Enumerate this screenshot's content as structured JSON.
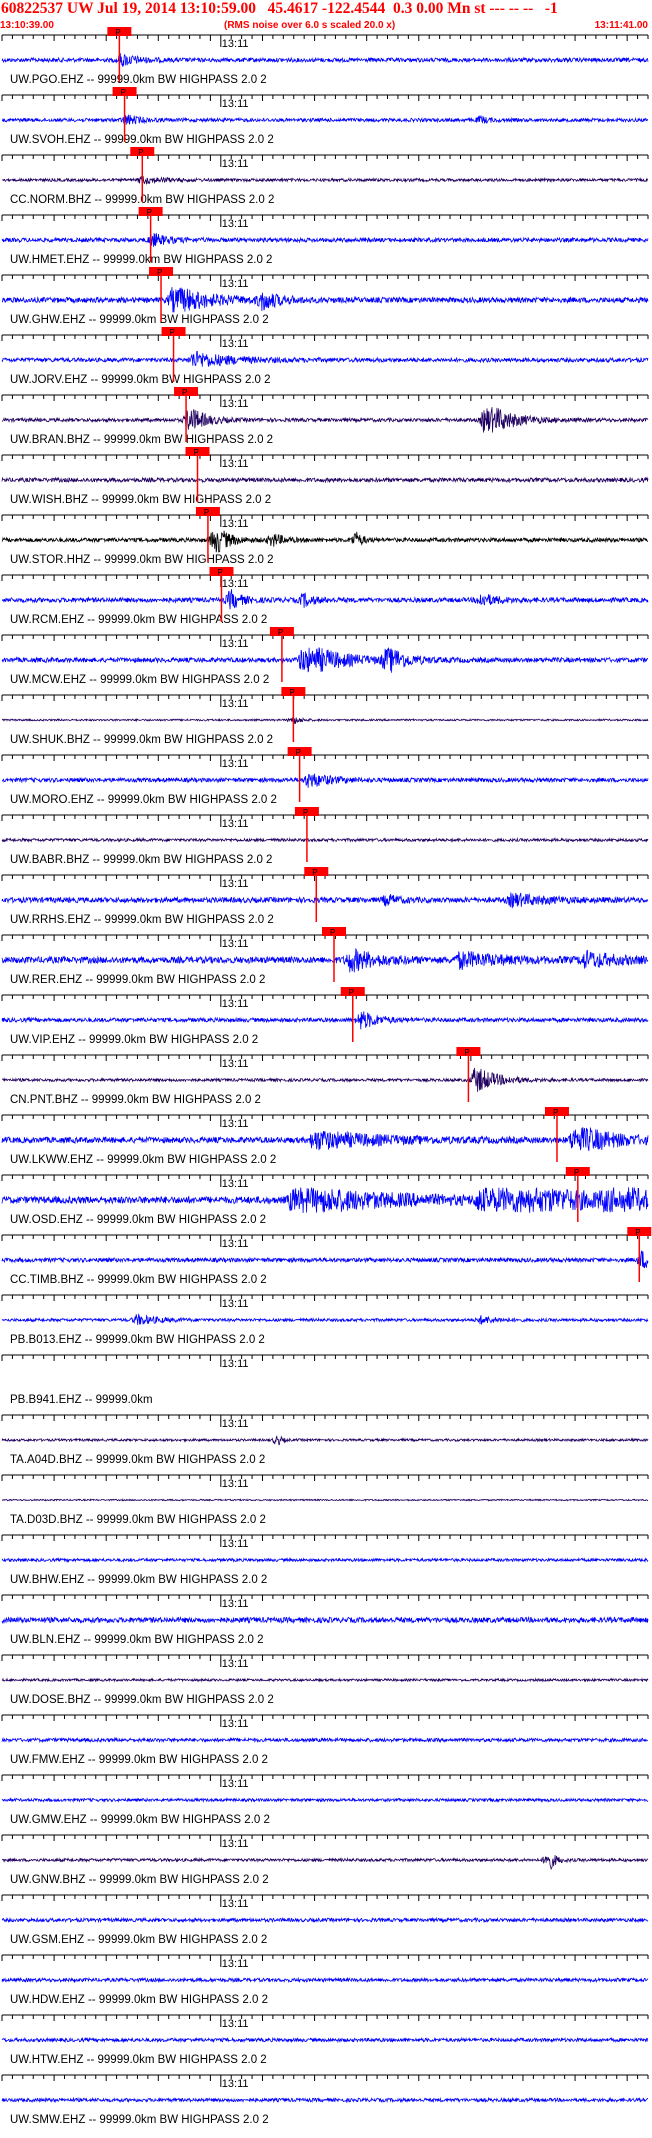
{
  "header": {
    "title": "60822537 UW Jul 19, 2014 13:10:59.00   45.4617 -122.4544  0.3 0.00 Mn st --- -- --   -1",
    "start_time": "13:10:39.00",
    "note": "(RMS noise over 6.0 s scaled 20.0 x)",
    "end_time": "13:11:41.00"
  },
  "chart_data": {
    "type": "line",
    "title": "60822537 UW Jul 19, 2014 13:10:59.00   45.4617 -122.4544  0.3 0.00 Mn st --- -- --   -1",
    "x_start": "13:10:39.00",
    "x_end": "13:11:41.00",
    "x_range_seconds": [
      0,
      62
    ],
    "minute_tick_label": "13:11",
    "minute_tick_seconds": 21,
    "tick_interval_seconds": 1,
    "pick_label": "P",
    "colors": {
      "blue": "#0000ff",
      "navy": "#200060",
      "black": "#000000",
      "pick": "#ff0000",
      "label_text": "#000000"
    },
    "series": [
      {
        "label": "UW.PGO.EHZ -- 99999.0km BW  HIGHPASS  2.0  2",
        "color": "#0000ff",
        "pick": 10.4,
        "amp": 0.35,
        "bursts": [
          [
            11.5,
            1.0,
            1.5
          ]
        ]
      },
      {
        "label": "UW.SVOH.EHZ -- 99999.0km BW  HIGHPASS  2.0  2",
        "color": "#0000ff",
        "pick": 10.9,
        "amp": 0.3,
        "bursts": [
          [
            12.0,
            0.8,
            1.2
          ],
          [
            46,
            0.5,
            0.8
          ]
        ]
      },
      {
        "label": "CC.NORM.BHZ -- 99999.0km BW  HIGHPASS  2.0  2",
        "color": "#200060",
        "pick": 12.6,
        "amp": 0.25,
        "bursts": [
          [
            13.5,
            0.6,
            2.0
          ]
        ]
      },
      {
        "label": "UW.HMET.EHZ -- 99999.0km BW  HIGHPASS  2.0  2",
        "color": "#0000ff",
        "pick": 13.4,
        "amp": 0.35,
        "bursts": [
          [
            14.5,
            1.0,
            1.5
          ]
        ]
      },
      {
        "label": "UW.GHW.EHZ -- 99999.0km BW  HIGHPASS  2.0  2",
        "color": "#0000ff",
        "pick": 14.4,
        "amp": 0.45,
        "bursts": [
          [
            16.5,
            2.5,
            3.0
          ],
          [
            25,
            1.5,
            1.5
          ]
        ]
      },
      {
        "label": "UW.JORV.EHZ -- 99999.0km BW  HIGHPASS  2.0  2",
        "color": "#0000ff",
        "pick": 15.6,
        "amp": 0.35,
        "bursts": [
          [
            18.5,
            1.3,
            3.5
          ]
        ]
      },
      {
        "label": "UW.BRAN.BHZ -- 99999.0km BW  HIGHPASS  2.0  2",
        "color": "#200060",
        "pick": 16.8,
        "amp": 0.3,
        "bursts": [
          [
            18.0,
            2.2,
            1.5
          ],
          [
            46.5,
            3.0,
            2.2
          ]
        ]
      },
      {
        "label": "UW.WISH.BHZ -- 99999.0km BW  HIGHPASS  2.0  2",
        "color": "#200060",
        "pick": 17.9,
        "amp": 0.35,
        "bursts": []
      },
      {
        "label": "UW.STOR.HHZ -- 99999.0km BW  HIGHPASS  2.0  2",
        "color": "#000000",
        "pick": 18.9,
        "amp": 0.35,
        "bursts": [
          [
            20.5,
            2.5,
            1.2
          ],
          [
            26,
            1.0,
            1.0
          ],
          [
            34,
            1.2,
            0.6
          ]
        ]
      },
      {
        "label": "UW.RCM.EHZ -- 99999.0km BW  HIGHPASS  2.0  2",
        "color": "#0000ff",
        "pick": 20.2,
        "amp": 0.4,
        "bursts": [
          [
            22.0,
            1.5,
            1.0
          ],
          [
            29,
            1.0,
            1.0
          ],
          [
            46,
            1.0,
            1.5
          ]
        ]
      },
      {
        "label": "UW.MCW.EHZ -- 99999.0km BW  HIGHPASS  2.0  2",
        "color": "#0000ff",
        "pick": 26.0,
        "amp": 0.4,
        "bursts": [
          [
            29.0,
            3.0,
            3.0
          ],
          [
            37,
            2.5,
            1.5
          ]
        ]
      },
      {
        "label": "UW.SHUK.BHZ -- 99999.0km BW  HIGHPASS  2.0  2",
        "color": "#200060",
        "pick": 27.1,
        "amp": 0.15,
        "bursts": [
          [
            28.0,
            0.6,
            0.8
          ]
        ]
      },
      {
        "label": "UW.MORO.EHZ -- 99999.0km BW  HIGHPASS  2.0  2",
        "color": "#0000ff",
        "pick": 27.7,
        "amp": 0.35,
        "bursts": [
          [
            29.5,
            1.2,
            2.0
          ]
        ]
      },
      {
        "label": "UW.BABR.BHZ -- 99999.0km BW  HIGHPASS  2.0  2",
        "color": "#200060",
        "pick": 28.4,
        "amp": 0.25,
        "bursts": []
      },
      {
        "label": "UW.RRHS.EHZ -- 99999.0km BW  HIGHPASS  2.0  2",
        "color": "#0000ff",
        "pick": 29.3,
        "amp": 0.45,
        "bursts": [
          [
            37,
            0.8,
            1.0
          ],
          [
            49,
            1.0,
            3.0
          ]
        ]
      },
      {
        "label": "UW.RER.EHZ -- 99999.0km BW  HIGHPASS  2.0  2",
        "color": "#0000ff",
        "pick": 31.0,
        "amp": 0.55,
        "bursts": [
          [
            33.5,
            1.8,
            2.5
          ],
          [
            44,
            1.2,
            4.0
          ],
          [
            56,
            1.2,
            3.0
          ]
        ]
      },
      {
        "label": "UW.VIP.EHZ -- 99999.0km BW  HIGHPASS  2.0  2",
        "color": "#0000ff",
        "pick": 32.8,
        "amp": 0.35,
        "bursts": [
          [
            34.5,
            1.5,
            1.5
          ]
        ]
      },
      {
        "label": "CN.PNT.BHZ -- 99999.0km BW  HIGHPASS  2.0  2",
        "color": "#200060",
        "pick": 43.9,
        "amp": 0.25,
        "bursts": [
          [
            45.5,
            2.2,
            2.0
          ]
        ]
      },
      {
        "label": "UW.LKWW.EHZ -- 99999.0km BW  HIGHPASS  2.0  2",
        "color": "#0000ff",
        "pick": 52.4,
        "amp": 0.5,
        "bursts": [
          [
            30,
            1.5,
            6.0
          ],
          [
            55,
            2.5,
            3.5
          ]
        ]
      },
      {
        "label": "UW.OSD.EHZ -- 99999.0km BW  HIGHPASS  2.0  2",
        "color": "#0000ff",
        "pick": 54.4,
        "amp": 0.6,
        "bursts": [
          [
            28,
            2.5,
            8.0
          ],
          [
            46,
            3.5,
            8.0
          ],
          [
            58,
            2.5,
            3.0
          ]
        ]
      },
      {
        "label": "CC.TIMB.BHZ -- 99999.0km BW  HIGHPASS  2.0  2",
        "color": "#0000ff",
        "pick": 60.3,
        "amp": 0.35,
        "bursts": [
          [
            61.5,
            1.5,
            0.8
          ]
        ]
      },
      {
        "label": "PB.B013.EHZ -- 99999.0km BW  HIGHPASS  2.0  2",
        "color": "#0000ff",
        "pick": null,
        "amp": 0.25,
        "bursts": [
          [
            13,
            0.8,
            2.0
          ],
          [
            46,
            0.6,
            1.5
          ]
        ]
      },
      {
        "label": "PB.B941.EHZ -- 99999.0km",
        "color": "#0000ff",
        "pick": null,
        "amp": 0.0,
        "bursts": []
      },
      {
        "label": "TA.A04D.BHZ -- 99999.0km BW  HIGHPASS  2.0  2",
        "color": "#200060",
        "pick": null,
        "amp": 0.2,
        "bursts": [
          [
            26.5,
            0.8,
            0.4
          ]
        ]
      },
      {
        "label": "TA.D03D.BHZ -- 99999.0km BW  HIGHPASS  2.0  2",
        "color": "#200060",
        "pick": null,
        "amp": 0.12,
        "bursts": []
      },
      {
        "label": "UW.BHW.EHZ -- 99999.0km BW  HIGHPASS  2.0  2",
        "color": "#0000ff",
        "pick": null,
        "amp": 0.25,
        "bursts": []
      },
      {
        "label": "UW.BLN.EHZ -- 99999.0km BW  HIGHPASS  2.0  2",
        "color": "#0000ff",
        "pick": null,
        "amp": 0.45,
        "bursts": []
      },
      {
        "label": "UW.DOSE.BHZ -- 99999.0km BW  HIGHPASS  2.0  2",
        "color": "#200060",
        "pick": null,
        "amp": 0.2,
        "bursts": []
      },
      {
        "label": "UW.FMW.EHZ -- 99999.0km BW  HIGHPASS  2.0  2",
        "color": "#0000ff",
        "pick": null,
        "amp": 0.3,
        "bursts": []
      },
      {
        "label": "UW.GMW.EHZ -- 99999.0km BW  HIGHPASS  2.0  2",
        "color": "#0000ff",
        "pick": null,
        "amp": 0.25,
        "bursts": []
      },
      {
        "label": "UW.GNW.BHZ -- 99999.0km BW  HIGHPASS  2.0  2",
        "color": "#200060",
        "pick": null,
        "amp": 0.25,
        "bursts": [
          [
            52.5,
            1.8,
            0.6
          ]
        ]
      },
      {
        "label": "UW.GSM.EHZ -- 99999.0km BW  HIGHPASS  2.0  2",
        "color": "#0000ff",
        "pick": null,
        "amp": 0.3,
        "bursts": []
      },
      {
        "label": "UW.HDW.EHZ -- 99999.0km BW  HIGHPASS  2.0  2",
        "color": "#0000ff",
        "pick": null,
        "amp": 0.3,
        "bursts": []
      },
      {
        "label": "UW.HTW.EHZ -- 99999.0km BW  HIGHPASS  2.0  2",
        "color": "#0000ff",
        "pick": null,
        "amp": 0.3,
        "bursts": []
      },
      {
        "label": "UW.SMW.EHZ -- 99999.0km BW  HIGHPASS  2.0  2",
        "color": "#0000ff",
        "pick": null,
        "amp": 0.3,
        "bursts": []
      }
    ]
  }
}
